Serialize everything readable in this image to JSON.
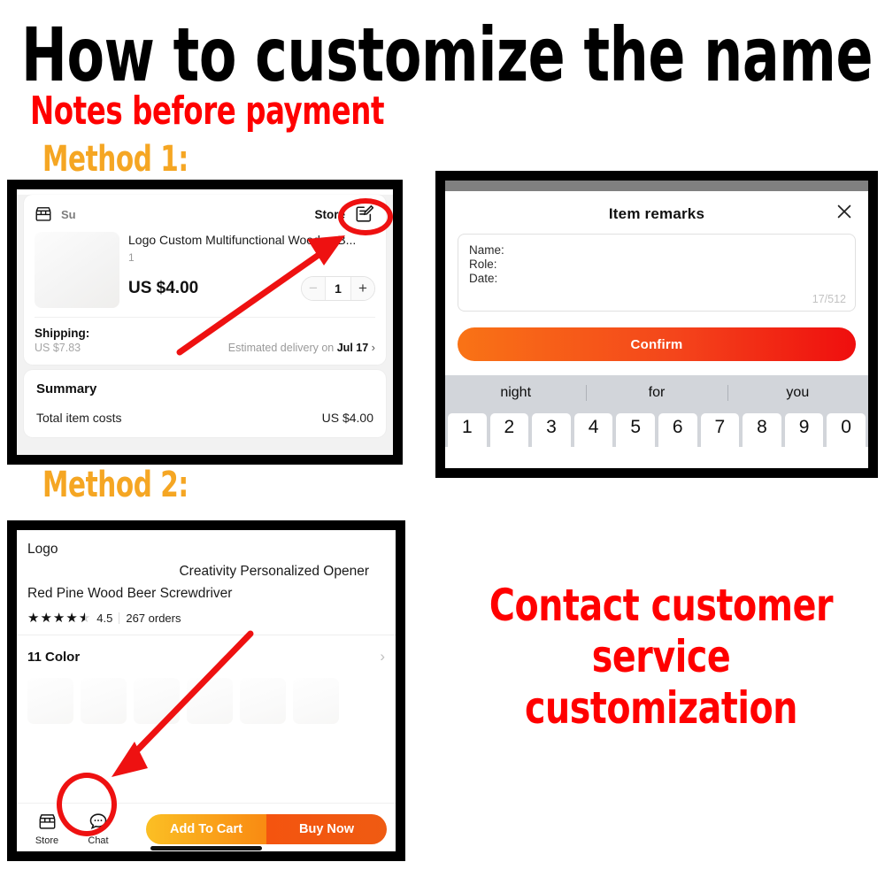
{
  "headline": "How to customize the name ???",
  "subhead": "Notes before payment",
  "method1_label": "Method 1:",
  "method2_label": "Method 2:",
  "contact": {
    "line1": "Contact customer",
    "line2": "service",
    "line3": "customization"
  },
  "colors": {
    "headline": "#000000",
    "subhead_red": "#ff0000",
    "method_amber": "#f5a623",
    "annotation_red": "#ee1111",
    "confirm_gradient_start": "#f97316",
    "confirm_gradient_end": "#ef0e0e",
    "add_to_cart_gradient_start": "#fbbf24",
    "add_to_cart_gradient_end": "#f98a12",
    "buy_now_gradient_start": "#f4540f",
    "buy_now_gradient_end": "#ef5b12",
    "keyboard_bg": "#d2d5da"
  },
  "cart_panel": {
    "store_icon": "storefront-icon",
    "store_name_faded": "Su",
    "store_name_main": "Store",
    "edit_icon": "note-edit-icon",
    "item_title": "Logo Custom Multifunctional Wooden B...",
    "item_sku": "1",
    "item_price": "US $4.00",
    "stepper": {
      "minus": "−",
      "value": "1",
      "plus": "+"
    },
    "shipping_label": "Shipping:",
    "shipping_cost": "US $7.83",
    "delivery_prefix": "Estimated delivery on",
    "delivery_date": "Jul 17",
    "delivery_chevron": "›",
    "summary_title": "Summary",
    "summary_row_label": "Total item costs",
    "summary_row_amount": "US $4.00"
  },
  "remarks_panel": {
    "title": "Item remarks",
    "close_icon": "close-icon",
    "textarea_lines": [
      "Name:",
      "Role:",
      "Date:"
    ],
    "char_count": "17/512",
    "confirm_label": "Confirm",
    "keyboard": {
      "suggestions": [
        "night",
        "for",
        "you"
      ],
      "number_keys": [
        "1",
        "2",
        "3",
        "4",
        "5",
        "6",
        "7",
        "8",
        "9",
        "0"
      ]
    }
  },
  "pdp_panel": {
    "title_line1": "Logo",
    "title_line2": "Creativity Personalized Opener",
    "title_line3": "Red Pine Wood Beer Screwdriver",
    "rating_value": "4.5",
    "orders_text": "267 orders",
    "stars_full": 4,
    "stars_half": 1,
    "color_label": "11 Color",
    "color_chevron": "›",
    "bottom_bar": {
      "store_label": "Store",
      "store_icon": "storefront-icon",
      "chat_label": "Chat",
      "chat_icon": "chat-bubble-icon",
      "add_to_cart_label": "Add To Cart",
      "buy_now_label": "Buy Now"
    }
  }
}
